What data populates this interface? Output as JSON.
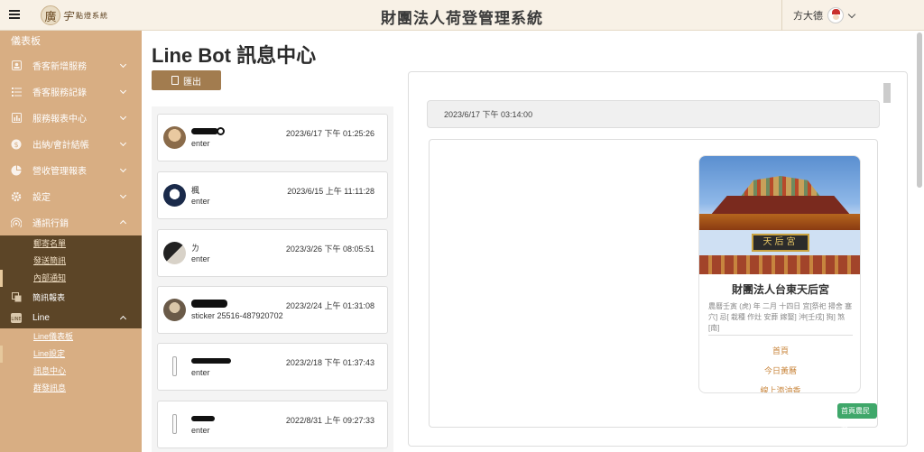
{
  "app": {
    "title": "財團法人荷登管理系統",
    "logo_mark": "廣",
    "logo_script": "宇",
    "logo_text": "點燈系統"
  },
  "user": {
    "name": "方大德"
  },
  "sidebar": {
    "dashboard": "儀表板",
    "items": [
      {
        "label": "香客新增服務"
      },
      {
        "label": "香客服務記錄"
      },
      {
        "label": "服務報表中心"
      },
      {
        "label": "出納/會計結帳"
      },
      {
        "label": "營收管理報表"
      },
      {
        "label": "設定"
      },
      {
        "label": "通訊行銷"
      }
    ],
    "marketing_sub": [
      "郵寄名單",
      "發送簡訊",
      "內部通知"
    ],
    "sms_report": "簡訊報表",
    "line": "Line",
    "line_sub": [
      "Line儀表板",
      "Line設定",
      "訊息中心",
      "群發訊息"
    ]
  },
  "main": {
    "title": "Line Bot 訊息中心",
    "export_label": "匯出"
  },
  "messages": [
    {
      "name": "",
      "msg": "enter",
      "time": "2023/6/17 下午 01:25:26"
    },
    {
      "name": "楓",
      "msg": "enter",
      "time": "2023/6/15 上午 11:11:28"
    },
    {
      "name": "ㄌ",
      "msg": "enter",
      "time": "2023/3/26 下午 08:05:51"
    },
    {
      "name": "",
      "msg": "sticker 25516-487920702",
      "time": "2023/2/24 上午 01:31:08"
    },
    {
      "name": "",
      "msg": "enter",
      "time": "2023/2/18 下午 01:37:43"
    },
    {
      "name": "",
      "msg": "enter",
      "time": "2022/8/31 上午 09:27:33"
    }
  ],
  "chat": {
    "top_timestamp": "2023/6/17 下午 03:14:00",
    "card": {
      "plaque": "天后宮",
      "title": "財團法人台東天后宮",
      "desc": "農曆壬寅 (虎) 年 二月 十四日 宜[祭祀 掃舍 塞穴] 忌[ 栽種 作灶 安葬 嫁娶] 沖[壬戌] 狗] 煞[南]",
      "links": [
        "首頁",
        "今日黃曆",
        "線上添油香"
      ],
      "tag": "首頁農民曆"
    }
  },
  "colors": {
    "sidebar": "#d8ae83",
    "sidebar_dark": "#5c4527",
    "topbar": "#f8f1e6",
    "accent_button": "#a27c4f",
    "tag_green": "#3fa76a"
  }
}
